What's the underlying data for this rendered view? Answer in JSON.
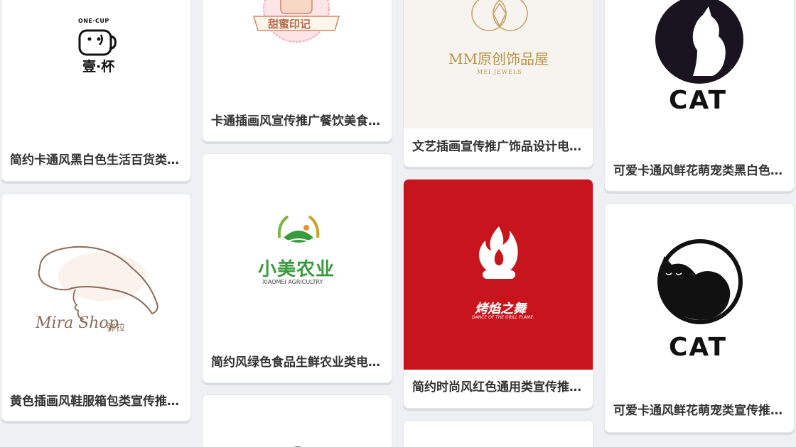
{
  "cards": [
    {
      "title": "简约卡通风黑白色生活百货类…",
      "logo_text": "壹·杯",
      "logo_sub": "ONE·CUP"
    },
    {
      "title": "黄色插画风鞋服箱包类宣传推…",
      "logo_text": "Mira Shop",
      "logo_sub": "弥拉"
    },
    {
      "title": "卡通插画风宣传推广餐饮美食…",
      "logo_text": "甜蜜印记"
    },
    {
      "title": "简约风绿色食品生鲜农业类电…",
      "logo_text": "小美农业",
      "logo_sub": "XIAOMEI AGRICULTRY"
    },
    {
      "title": "文艺插画宣传推广饰品设计电…",
      "logo_text": "MM原创饰品屋",
      "logo_sub": "MEI JEWELS"
    },
    {
      "title": "简约时尚风红色通用类宣传推…",
      "logo_text": "烤焰之舞",
      "logo_sub": "DANCE OF THE GRILL FLAME"
    },
    {
      "title": "可爱卡通风鲜花萌宠类黑白色…",
      "logo_text": "CAT"
    },
    {
      "title": "可爱卡通风鲜花萌宠类宣传推…",
      "logo_text": "CAT"
    }
  ],
  "colors": {
    "page_bg": "#eef0f3",
    "title_text": "#333333",
    "green": "#3a9a3e",
    "gold": "#b8924a",
    "red": "#c8141c"
  }
}
